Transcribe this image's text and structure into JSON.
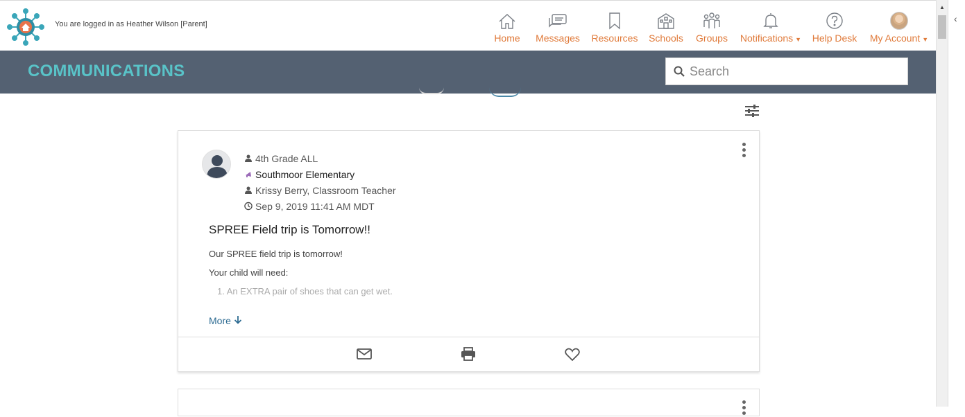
{
  "header": {
    "login_text": "You are logged in as Heather Wilson [Parent]",
    "nav": [
      {
        "label": "Home",
        "icon": "home-icon"
      },
      {
        "label": "Messages",
        "icon": "messages-icon"
      },
      {
        "label": "Resources",
        "icon": "bookmark-icon"
      },
      {
        "label": "Schools",
        "icon": "school-icon"
      },
      {
        "label": "Groups",
        "icon": "groups-icon"
      },
      {
        "label": "Notifications",
        "icon": "bell-icon",
        "dropdown": true
      },
      {
        "label": "Help Desk",
        "icon": "help-icon"
      },
      {
        "label": "My Account",
        "icon": "avatar",
        "dropdown": true
      }
    ],
    "accent_color": "#e07a3a"
  },
  "band": {
    "title": "COMMUNICATIONS",
    "search_placeholder": "Search",
    "background": "#546172",
    "title_color": "#59c3c8"
  },
  "post": {
    "group": "4th Grade ALL",
    "school": "Southmoor Elementary",
    "author": "Krissy Berry, Classroom Teacher",
    "datetime": "Sep 9, 2019 11:41 AM MDT",
    "title": "SPREE Field trip is Tomorrow!!",
    "body_line1": "Our SPREE field trip is tomorrow!",
    "body_line2": "Your child will need:",
    "list_item1": "1. An EXTRA pair of shoes that can get wet.",
    "more_label": "More"
  }
}
